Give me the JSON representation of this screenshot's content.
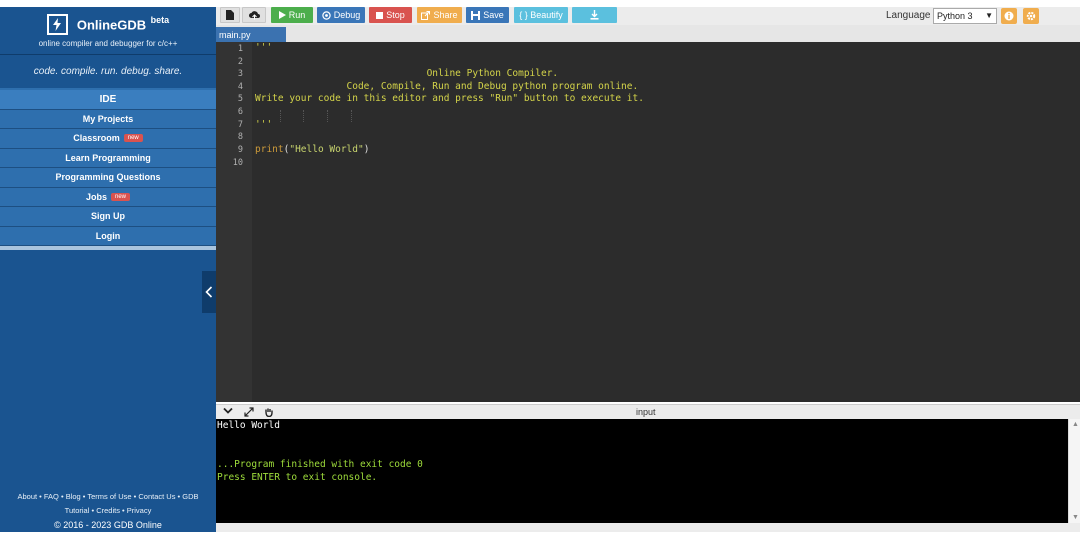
{
  "brand": {
    "name": "OnlineGDB",
    "beta": "beta",
    "tagline": "online compiler and debugger for c/c++",
    "slogan": "code. compile. run. debug. share."
  },
  "nav": [
    {
      "label": "IDE",
      "active": true
    },
    {
      "label": "My Projects"
    },
    {
      "label": "Classroom",
      "badge": "new"
    },
    {
      "label": "Learn Programming"
    },
    {
      "label": "Programming Questions"
    },
    {
      "label": "Jobs",
      "badge": "new"
    },
    {
      "label": "Sign Up"
    },
    {
      "label": "Login"
    }
  ],
  "footer": {
    "links_line1": [
      "About",
      "FAQ",
      "Blog",
      "Terms of Use",
      "Contact Us",
      "GDB"
    ],
    "links_line2": [
      "Tutorial",
      "Credits",
      "Privacy"
    ],
    "copyright": "© 2016 - 2023 GDB Online"
  },
  "toolbar": {
    "run": "Run",
    "debug": "Debug",
    "stop": "Stop",
    "share": "Share",
    "save": "Save",
    "beautify": "{ } Beautify",
    "language_label": "Language",
    "language_value": "Python 3"
  },
  "editor": {
    "tab": "main.py",
    "line_numbers": [
      "1",
      "2",
      "3",
      "4",
      "5",
      "6",
      "7",
      "8",
      "9",
      "10"
    ],
    "lines": [
      "'''",
      "",
      "                              Online Python Compiler.",
      "                Code, Compile, Run and Debug python program online.",
      "Write your code in this editor and press \"Run\" button to execute it.",
      "",
      "'''",
      "",
      "",
      ""
    ],
    "print_fn": "print",
    "print_open": "(",
    "print_arg": "\"Hello World\"",
    "print_close": ")"
  },
  "console": {
    "title": "input",
    "output": [
      "Hello World",
      "",
      "",
      "...Program finished with exit code 0",
      "Press ENTER to exit console."
    ]
  },
  "colors": {
    "sidebar": "#1a5490",
    "nav": "#2e6fae",
    "run": "#4cae4c",
    "debug": "#3a76b8",
    "stop": "#d9534f",
    "share": "#f0ad4e",
    "beautify": "#5bc0de",
    "editor_bg": "#2c2c2c",
    "console_text": "#9edc3b"
  }
}
